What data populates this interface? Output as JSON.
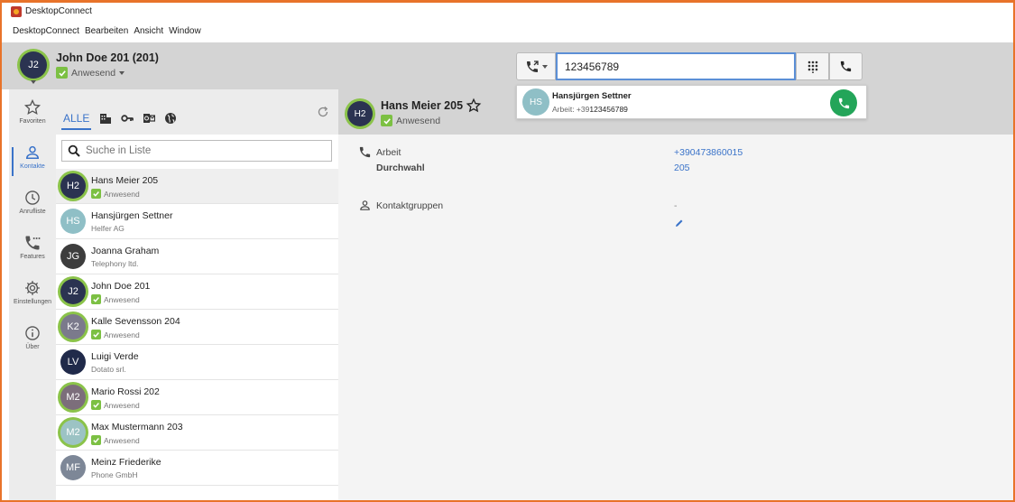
{
  "window": {
    "title": "DesktopConnect"
  },
  "menu": [
    "DesktopConnect",
    "Bearbeiten",
    "Ansicht",
    "Window"
  ],
  "me": {
    "initials": "J2",
    "name": "John Doe 201 (201)",
    "status": "Anwesend"
  },
  "dial": {
    "value": "123456789",
    "placeholder": ""
  },
  "suggestion": {
    "initials": "HS",
    "name": "Hansjürgen Settner",
    "number_prefix": "Arbeit: +39",
    "number_match": "123456789"
  },
  "sidebar": {
    "items": [
      {
        "label": "Favoriten",
        "icon": "star-icon"
      },
      {
        "label": "Kontakte",
        "icon": "person-icon"
      },
      {
        "label": "Anrufliste",
        "icon": "clock-icon"
      },
      {
        "label": "Features",
        "icon": "phone-dots-icon"
      },
      {
        "label": "Einstellungen",
        "icon": "gear-icon"
      },
      {
        "label": "Über",
        "icon": "info-icon"
      }
    ]
  },
  "tabs": {
    "alle": "ALLE"
  },
  "search": {
    "placeholder": "Suche in Liste"
  },
  "contacts": [
    {
      "initials": "H2",
      "name": "Hans Meier 205",
      "sub": "Anwesend",
      "present": true
    },
    {
      "initials": "HS",
      "name": "Hansjürgen Settner",
      "sub": "Helfer AG",
      "present": false
    },
    {
      "initials": "JG",
      "name": "Joanna Graham",
      "sub": "Telephony ltd.",
      "present": false
    },
    {
      "initials": "J2",
      "name": "John Doe 201",
      "sub": "Anwesend",
      "present": true
    },
    {
      "initials": "K2",
      "name": "Kalle Sevensson 204",
      "sub": "Anwesend",
      "present": true
    },
    {
      "initials": "LV",
      "name": "Luigi Verde",
      "sub": "Dotato srl.",
      "present": false
    },
    {
      "initials": "M2",
      "name": "Mario Rossi 202",
      "sub": "Anwesend",
      "present": true
    },
    {
      "initials": "M2",
      "name": "Max Mustermann 203",
      "sub": "Anwesend",
      "present": true
    },
    {
      "initials": "MF",
      "name": "Meinz Friederike",
      "sub": "Phone GmbH",
      "present": false
    }
  ],
  "detail": {
    "initials": "H2",
    "name": "Hans Meier 205",
    "status": "Anwesend",
    "arbeit_label": "Arbeit",
    "arbeit_value": "+390473860015",
    "durchwahl_label": "Durchwahl",
    "durchwahl_value": "205",
    "gruppen_label": "Kontaktgruppen",
    "gruppen_value": "-"
  },
  "colors": {
    "accent": "#3a73c9",
    "presence": "#7cc043",
    "call": "#23a559",
    "frame": "#e8732a"
  }
}
